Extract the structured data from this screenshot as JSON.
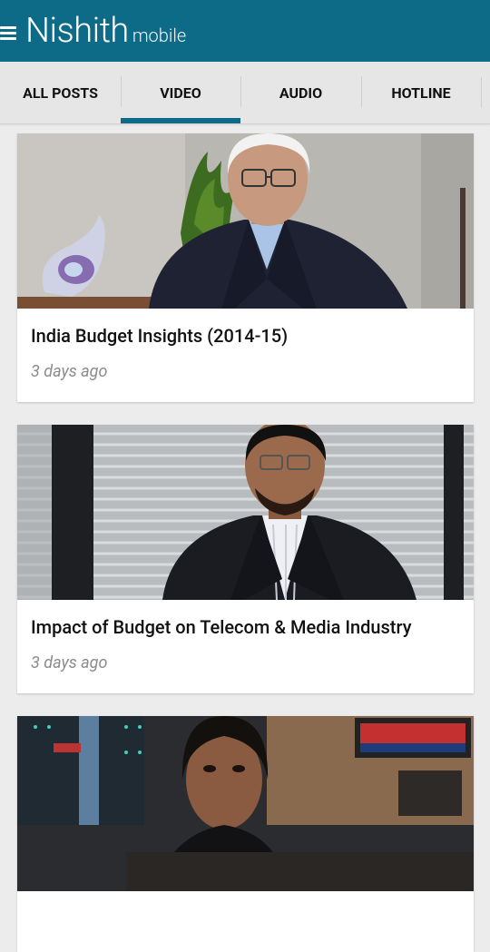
{
  "theme": {
    "brand": "#0e6b87"
  },
  "appbar": {
    "logo_main": "Nishith",
    "logo_sub": "mobile"
  },
  "tabs": [
    {
      "label": "ALL POSTS",
      "active": false
    },
    {
      "label": "VIDEO",
      "active": true
    },
    {
      "label": "AUDIO",
      "active": false
    },
    {
      "label": "HOTLINE",
      "active": false
    }
  ],
  "posts": [
    {
      "title": "India Budget Insights (2014-15)",
      "meta": "3 days ago"
    },
    {
      "title": "Impact of Budget on Telecom & Media Industry",
      "meta": "3 days ago"
    },
    {
      "title": "",
      "meta": ""
    }
  ]
}
